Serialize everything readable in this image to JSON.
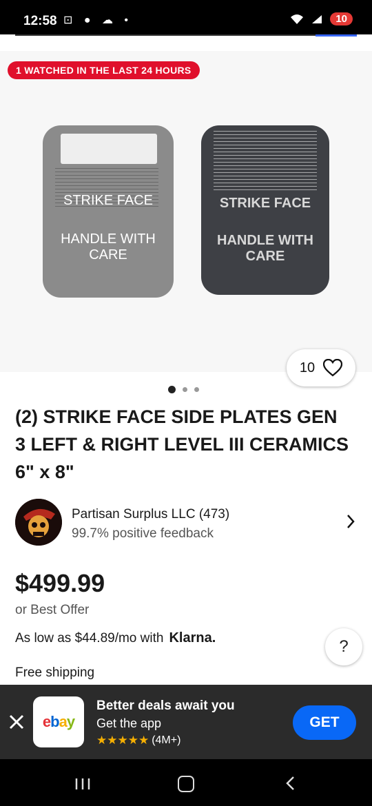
{
  "status_bar": {
    "time": "12:58",
    "battery": "10"
  },
  "badge": {
    "text": "1 WATCHED IN THE LAST 24 HOURS"
  },
  "product_image": {
    "left_plate": {
      "line1": "STRIKE FACE",
      "line2": "HANDLE WITH CARE"
    },
    "right_plate": {
      "line1": "STRIKE FACE",
      "line2": "HANDLE WITH CARE"
    }
  },
  "watchers": {
    "count": "10"
  },
  "carousel": {
    "total": 3,
    "active": 1
  },
  "listing": {
    "title": "(2) STRIKE FACE SIDE PLATES GEN 3 LEFT & RIGHT LEVEL III CERAMICS 6\" x 8\"",
    "seller_name": "Partisan Surplus LLC (473)",
    "seller_feedback": "99.7% positive feedback",
    "price": "$499.99",
    "best_offer": "or Best Offer",
    "financing": "As low as $44.89/mo with",
    "financing_brand": "Klarna.",
    "shipping": "Free shipping"
  },
  "app_banner": {
    "title": "Better deals await you",
    "subtitle": "Get the app",
    "rating_count": "(4M+)",
    "get_label": "GET",
    "logo": {
      "e": "e",
      "b": "b",
      "a": "a",
      "y": "y"
    }
  },
  "help_label": "?",
  "colors": {
    "accent_red": "#e0102c",
    "ebay_blue": "#0968f6",
    "banner_bg": "#2b2b2b"
  }
}
